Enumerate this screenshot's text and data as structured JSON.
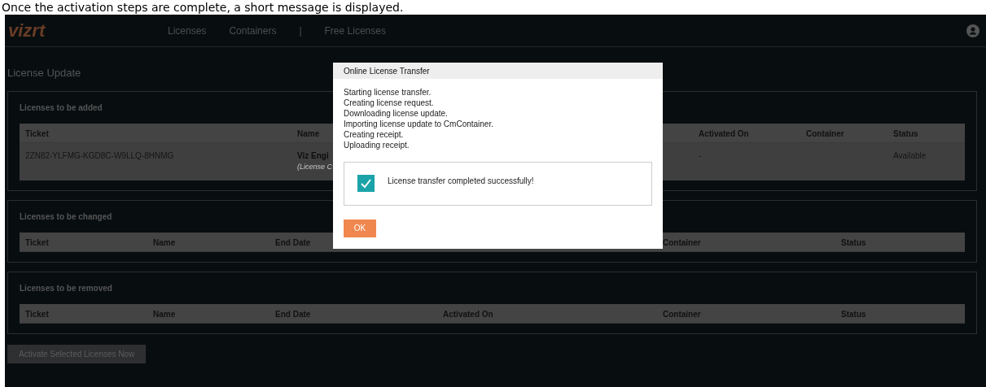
{
  "caption": "Once the activation steps are complete, a short message is displayed.",
  "header": {
    "logo": "vizrt",
    "nav_groups": [
      [
        "Licenses",
        "Containers"
      ],
      [
        "Free Licenses"
      ]
    ],
    "separator": "|"
  },
  "page_title": "License Update",
  "sections": [
    {
      "title": "Licenses to be added",
      "columns": [
        "Ticket",
        "Name",
        "Activated On",
        "Container",
        "Status"
      ],
      "rows": [
        [
          {
            "text": "2ZN82-YLFMG-KGD8C-W9LLQ-8HNMG"
          },
          {
            "text": "Viz Engi",
            "sub": "(License C"
          },
          {
            "text": "-"
          },
          {
            "text": ""
          },
          {
            "text": "Available"
          }
        ]
      ]
    },
    {
      "title": "Licenses to be changed",
      "columns": [
        "Ticket",
        "Name",
        "End Date",
        "Container",
        "Status"
      ]
    },
    {
      "title": "Licenses to be removed",
      "columns": [
        "Ticket",
        "Name",
        "End Date",
        "Activated On",
        "Container",
        "Status"
      ]
    }
  ],
  "activate_button": {
    "label": "Activate Selected Licenses Now",
    "disabled": true
  },
  "dialog": {
    "title": "Online License Transfer",
    "steps": [
      "Starting license transfer.",
      "Creating license request.",
      "Downloading license update.",
      "Importing license update to CmContainer.",
      "Creating receipt.",
      "Uploading receipt."
    ],
    "result": {
      "message": "License transfer completed successfully!",
      "success": true
    },
    "ok": "OK"
  }
}
